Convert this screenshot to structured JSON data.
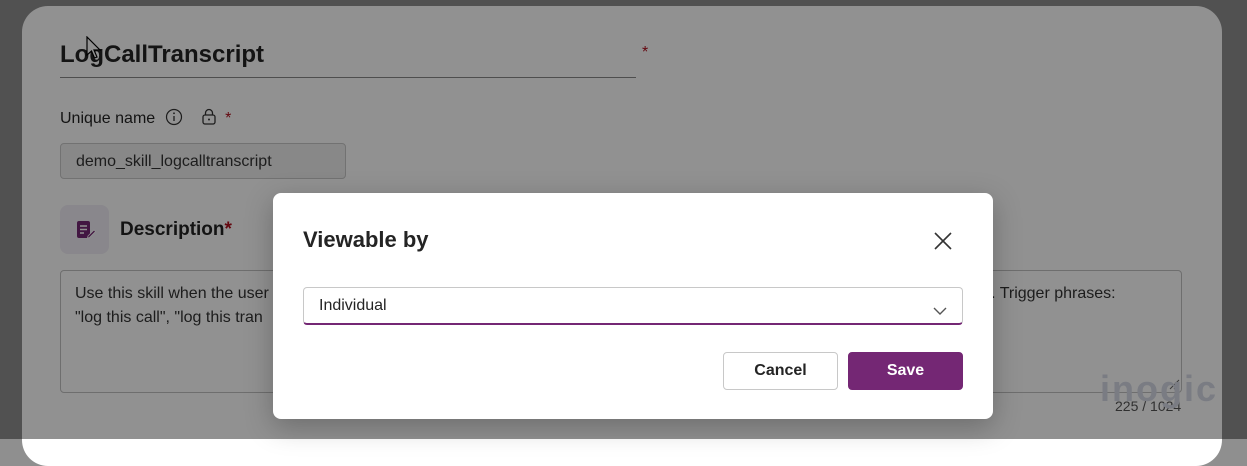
{
  "form": {
    "skill_title": "LogCallTranscript",
    "required_marker": "*",
    "unique_name_label": "Unique name",
    "unique_name_value": "demo_skill_logcalltranscript",
    "description_label": "Description",
    "description_text": "Use this skill when the user ... rse. Trigger phrases: \"log this call\", \"log this tran...",
    "description_line1_left": "Use this skill when the user",
    "description_line1_right": "rse. Trigger phrases:",
    "description_line2_left": "\"log this call\", \"log this tran",
    "char_counter": "225 / 1024",
    "watermark": "inogic"
  },
  "dialog": {
    "title": "Viewable by",
    "select_value": "Individual",
    "cancel_label": "Cancel",
    "save_label": "Save"
  },
  "colors": {
    "accent": "#742774",
    "required": "#b10e1c"
  },
  "icons": {
    "info": "info-icon",
    "lock": "lock-icon",
    "description": "notes-icon",
    "close": "close-icon",
    "chevron": "chevron-down-icon",
    "cursor": "mouse-pointer-icon"
  }
}
